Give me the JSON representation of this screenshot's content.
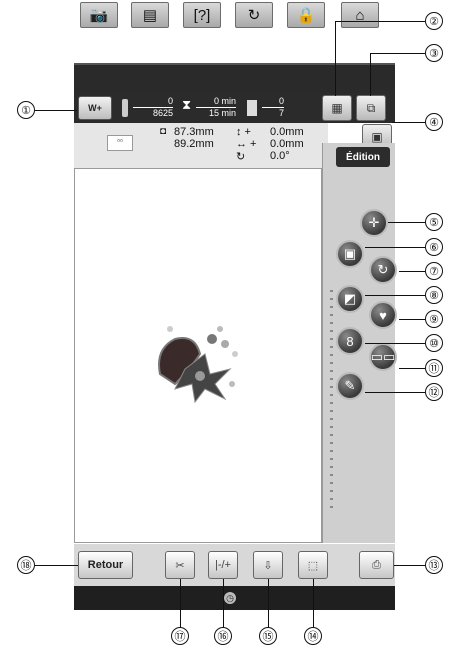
{
  "top_tabs": [
    "📷",
    "▤",
    "[?]",
    "↻",
    "🔒",
    "⌂"
  ],
  "status": {
    "w_label": "W+",
    "stitch_top": "0",
    "stitch_bottom": "8625",
    "time_top": "0 min",
    "time_bottom": "15 min",
    "color_top": "0",
    "color_bottom": "7"
  },
  "info": {
    "height": "87.3mm",
    "width": "89.2mm",
    "vertical_offset": "0.0mm",
    "horizontal_offset": "0.0mm",
    "rotation": "0.0°"
  },
  "edition_label": "Édition",
  "bottom": {
    "back_label": "Retour"
  },
  "callouts": [
    "①",
    "②",
    "③",
    "④",
    "⑤",
    "⑥",
    "⑦",
    "⑧",
    "⑨",
    "⑩",
    "⑪",
    "⑫",
    "⑬",
    "⑭",
    "⑮",
    "⑯",
    "⑰",
    "⑱"
  ]
}
